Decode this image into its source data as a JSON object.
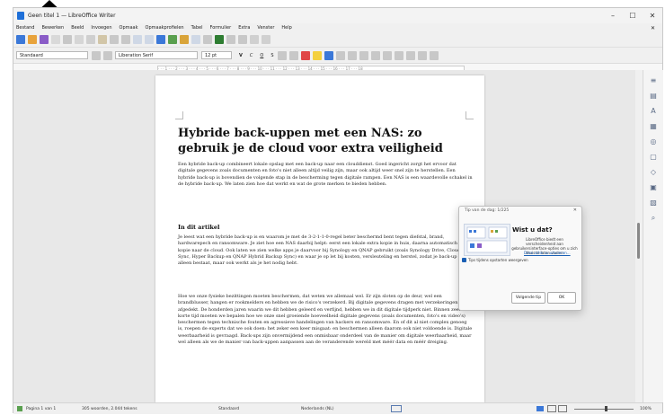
{
  "window": {
    "title": "Geen titel 1 — LibreOffice Writer",
    "minimize": "–",
    "maximize": "☐",
    "close": "✕"
  },
  "menu": {
    "items": [
      "Bestand",
      "Bewerken",
      "Beeld",
      "Invoegen",
      "Opmaak",
      "Opmaakprofielen",
      "Tabel",
      "Formulier",
      "Extra",
      "Venster",
      "Help"
    ],
    "close_doc": "✕"
  },
  "format": {
    "style": "Standaard",
    "font": "Liberation Serif",
    "size": "12 pt",
    "bold": "V",
    "italic": "C",
    "underline": "O",
    "strike": "S"
  },
  "ruler": {
    "scale": "· · · 1 · · · 2 · · · 3 · · · 4 · · · 5 · · · 6 · · · 7 · · · 8 · · · 9 · · · 10 · · · 11 · · · 12 · · · 13 · · · 14 · · · 15 · · · 16 · · · 17 · · · 18"
  },
  "doc": {
    "title": "Hybride back-uppen met een NAS: zo gebruik je de cloud voor extra veiligheid",
    "intro": "Een hybride back-up combineert lokale opslag met een back-up naar een clouddienst. Goed ingericht zorgt het ervoor dat digitale gegevens zoals documenten en foto's niet alleen altijd veilig zijn, maar ook altijd weer snel zijn te herstellen. Een hybride back-up is bovendien de volgende stap in de bescherming tegen digitale rampen. Een NAS is een waardevolle schakel in de hybride back-up. We laten zien hoe dat werkt en wat de grote merken te bieden hebben.",
    "section": "In dit artikel",
    "p2": "Je leest wat een hybride back-up is en waarom je met de 3-2-1-1-0-regel beter beschermd bent tegen diefstal, brand, hardwarepech en ransomware. Je ziet hoe een NAS daarbij helpt: eerst een lokale extra kopie in huis, daarna automatisch een kopie naar de cloud. Ook laten we zien welke apps je daarvoor bij Synology en QNAP gebruikt (zoals Synology Drive, Cloud Sync, Hyper Backup en QNAP Hybrid Backup Sync) en waar je op let bij kosten, versleuteling en herstel, zodat je back-up niet alleen bestaat, maar ook werkt als je het nodig hebt.",
    "p3": "Hoe we onze fysieke bezittingen moeten beschermen, dat weten we allemaal wel. Er zijn sloten op de deur, wel een brandblusser, hangen er rookmelders en hebben we de risico's verzekerd. Bij digitale gegevens dragen met verzekeringen afgedekt. De honderden jaren waarin we dit hebben geleerd en verfijnd, hebben we in dit digitale tijdperk niet. Binnen zeer korte tijd moeten we bepalen hoe we onze snel groeiende hoeveelheid digitale gegevens (zoals documenten, foto's en video's) beschermen tegen technische fouten en agressieve handelingen van hackers en ransomware. En of dit al niet complex genoeg is, roepen de experts dat we ook doen: het zeker een keer misgaat: en beschermen alleen daarom ook niet voldoende is. Digitale weerbaarheid is gevraagd. Back-ups zijn onvermijdend een onmisbaar onderdeel van de manier om digitale weerbaarheid, maar wel alleen als we de manier van back-uppen aanpassen aan de veranderende wereld met méér data en méér dreiging."
  },
  "dialog": {
    "title": "Tip van de dag: 1/225",
    "close": "✕",
    "heading": "Wist u dat?",
    "body": "LibreOffice biedt een verscheidenheid aan gebruikersinterface-opties om u zich thuis te laten voelen",
    "link": "Deze actie nu uitvoeren...",
    "checkbox": "Tips tijdens opstarten weergeven",
    "next": "Volgende tip",
    "ok": "OK"
  },
  "status": {
    "page": "Pagina 1 van 1",
    "words": "305 woorden, 2.044 tekens",
    "style": "Standaard",
    "lang": "Nederlands (NL)",
    "zoom": "100%"
  },
  "colors": {
    "accent": "#1a5fb4",
    "writer_blue": "#1e6fd8",
    "dialog_bg": "#f9f9f9"
  }
}
